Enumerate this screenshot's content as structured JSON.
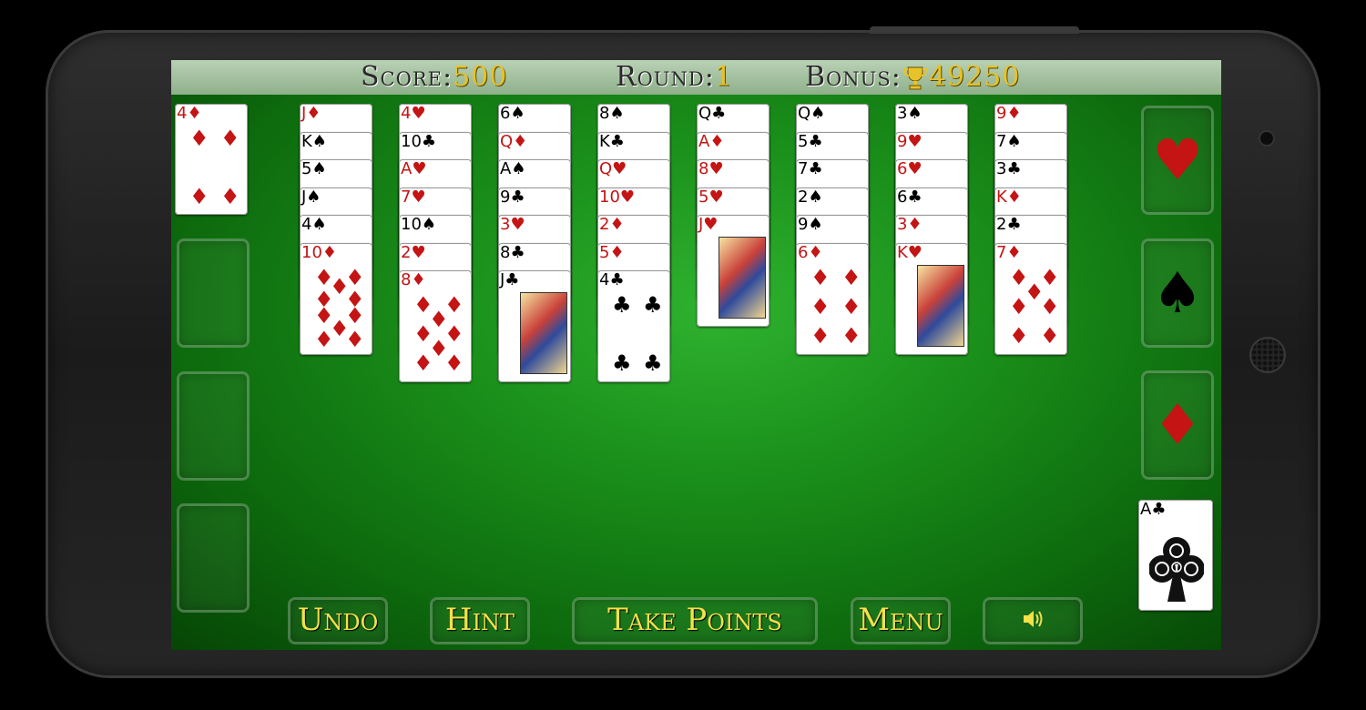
{
  "header": {
    "score_label": "Score:",
    "score_value": "500",
    "round_label": "Round:",
    "round_value": "1",
    "bonus_label": "Bonus:",
    "bonus_value": "49250"
  },
  "stock_card": "4♦",
  "tableau": [
    [
      "J♦",
      "K♠",
      "5♠",
      "J♠",
      "4♠",
      "10♦"
    ],
    [
      "4♥",
      "10♣",
      "A♥",
      "7♥",
      "10♠",
      "2♥",
      "8♦"
    ],
    [
      "6♠",
      "Q♦",
      "A♠",
      "9♣",
      "3♥",
      "8♣",
      "J♣"
    ],
    [
      "8♠",
      "K♣",
      "Q♥",
      "10♥",
      "2♦",
      "5♦",
      "4♣"
    ],
    [
      "Q♣",
      "A♦",
      "8♥",
      "5♥",
      "J♥"
    ],
    [
      "Q♠",
      "5♣",
      "7♣",
      "2♠",
      "9♠",
      "6♦"
    ],
    [
      "3♠",
      "9♥",
      "6♥",
      "6♣",
      "3♦",
      "K♥"
    ],
    [
      "9♦",
      "7♠",
      "3♣",
      "K♦",
      "2♣",
      "7♦"
    ]
  ],
  "foundations": [
    {
      "suit": "♥",
      "color": "#c41414"
    },
    {
      "suit": "♠",
      "color": "#000000"
    },
    {
      "suit": "♦",
      "color": "#c41414"
    }
  ],
  "foundation_card": "A♣",
  "buttons": {
    "undo": "Undo",
    "hint": "Hint",
    "take_points": "Take Points",
    "menu": "Menu",
    "sound_icon": "speaker-icon"
  },
  "colors": {
    "felt": "#1a8f1a",
    "header_bar": "#a9c4a5",
    "gold": "#e7c22a",
    "red_suit": "#c41414"
  }
}
